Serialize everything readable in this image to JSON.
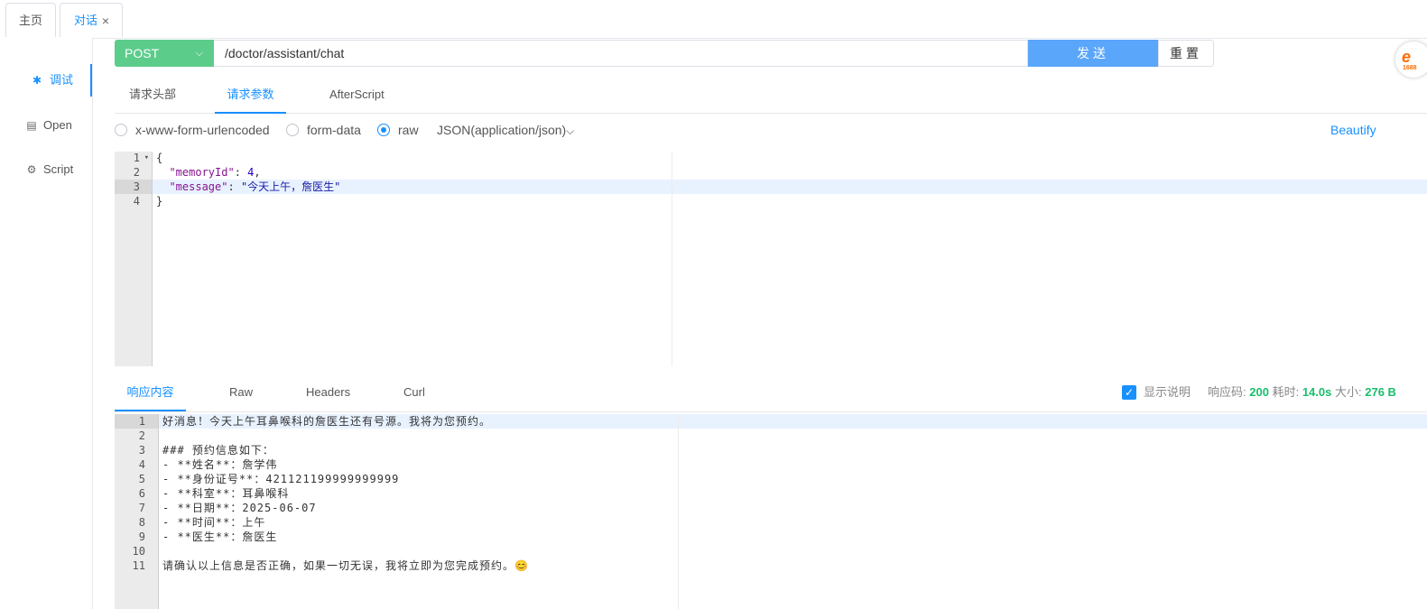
{
  "tabs": {
    "home": "主页",
    "chat": "对话",
    "close": "×"
  },
  "sidebar": {
    "items": [
      {
        "icon": "✱",
        "label": "调试"
      },
      {
        "icon": "▤",
        "label": "Open"
      },
      {
        "icon": "⚙",
        "label": "Script"
      }
    ]
  },
  "request": {
    "method": "POST",
    "method_chevron": "⌵",
    "url": "/doctor/assistant/chat",
    "send_label": "发送",
    "reset_label": "重置",
    "tabs": [
      "请求头部",
      "请求参数",
      "AfterScript"
    ],
    "active_tab": "请求参数",
    "body_types": [
      "x-www-form-urlencoded",
      "form-data",
      "raw"
    ],
    "selected_body_type": "raw",
    "content_type": "JSON(application/json)",
    "content_type_chevron": "⌵",
    "beautify_label": "Beautify",
    "body_lines": {
      "l1": "{",
      "l2_key": "\"memoryId\"",
      "l2_sep": ": ",
      "l2_val": "4",
      "l2_end": ",",
      "l3_key": "\"message\"",
      "l3_sep": ": ",
      "l3_val": "\"今天上午，詹医生\"",
      "l4": "}"
    },
    "line_numbers": [
      "1",
      "2",
      "3",
      "4"
    ],
    "fold_marker": "▾"
  },
  "response": {
    "tabs": [
      "响应内容",
      "Raw",
      "Headers",
      "Curl"
    ],
    "active_tab": "响应内容",
    "show_desc_label": "显示说明",
    "status_label": "响应码:",
    "status_value": "200",
    "time_label": "耗时:",
    "time_value": "14.0s",
    "size_label": "大小:",
    "size_value": "276 B",
    "lines": [
      "好消息！今天上午耳鼻喉科的詹医生还有号源。我将为您预约。",
      "",
      "### 预约信息如下：",
      "- **姓名**：詹学伟",
      "- **身份证号**：421121199999999999",
      "- **科室**：耳鼻喉科",
      "- **日期**：2025-06-07",
      "- **时间**：上午",
      "- **医生**：詹医生",
      "",
      "请确认以上信息是否正确，如果一切无误，我将立即为您完成预约。😊"
    ],
    "line_numbers": [
      "1",
      "2",
      "3",
      "4",
      "5",
      "6",
      "7",
      "8",
      "9",
      "10",
      "11"
    ]
  },
  "logo": {
    "text": "e",
    "sub": "1688"
  },
  "colors": {
    "accent": "#1890ff",
    "method": "#5ccc8b",
    "send": "#5aa6fb",
    "status_ok": "#19be6b"
  }
}
